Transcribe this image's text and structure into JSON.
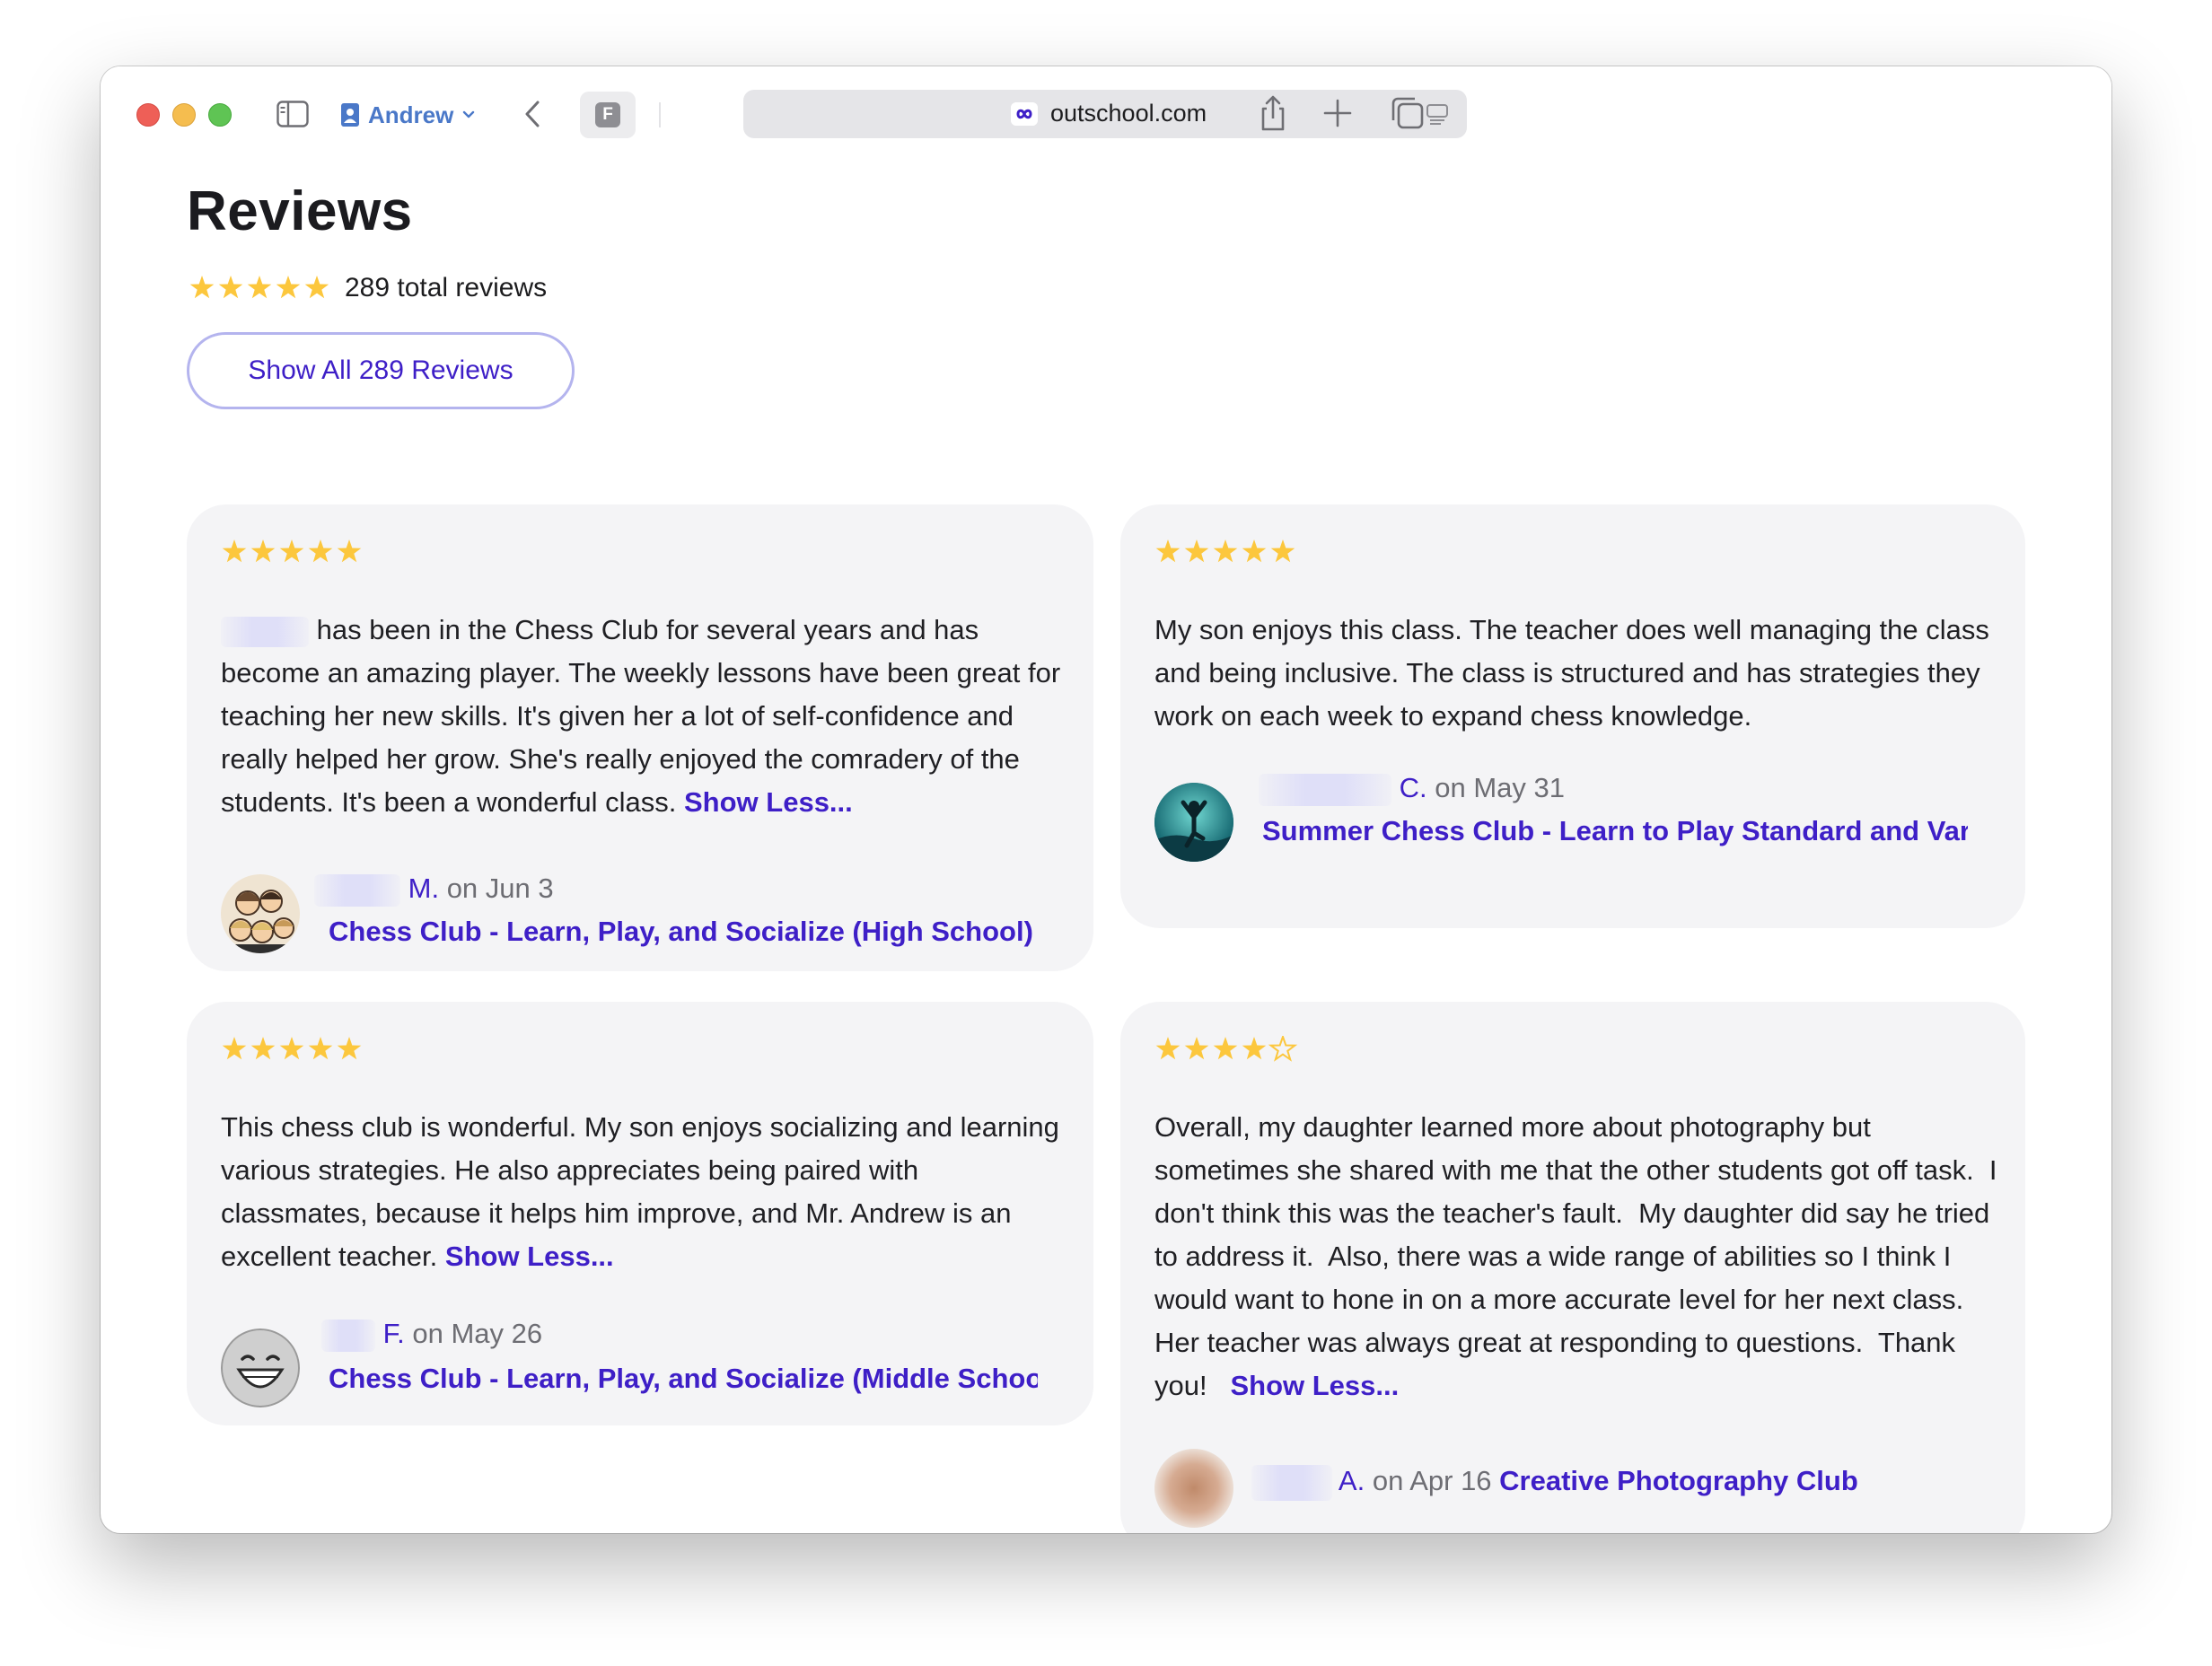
{
  "browser": {
    "profile_name": "Andrew",
    "favicon_letter": "F",
    "url": "outschool.com"
  },
  "page": {
    "title": "Reviews",
    "total_reviews": "289 total reviews",
    "show_all_label": "Show All 289 Reviews",
    "overall_rating": 5
  },
  "colors": {
    "accent": "#3e1fc7",
    "star": "#fcc73d",
    "card_bg": "#f4f4f6"
  },
  "reviews": [
    {
      "rating": 5,
      "text": "has been in the Chess Club for several years and has become an amazing player. The weekly lessons have been great for teaching her new skills. It's given her a lot of self-confidence and really helped her grow. She's really enjoyed the comradery of the students. It's been a wonderful class.",
      "show_less": "Show Less...",
      "initial": "M.",
      "date": "on Jun 3",
      "class_title": "Chess Club - Learn, Play, and Socialize (High School)",
      "avatar": "family-cartoon-avatar"
    },
    {
      "rating": 5,
      "text": "My son enjoys this class. The teacher does well managing the class and being inclusive. The class is structured and has strategies they work on each week to expand chess knowledge.",
      "show_less": "",
      "initial": "C.",
      "date": "on May 31",
      "class_title": "Summer Chess Club - Learn to Play Standard and Variant Chess",
      "avatar": "yoga-silhouette-avatar"
    },
    {
      "rating": 5,
      "text": "This chess club is wonderful. My son enjoys socializing and learning various strategies. He also appreciates being paired with classmates, because it helps him improve, and Mr. Andrew is an excellent teacher.",
      "show_less": "Show Less...",
      "initial": "F.",
      "date": "on May 26",
      "class_title": "Chess Club - Learn, Play, and Socialize (Middle School)",
      "avatar": "grinning-face-avatar"
    },
    {
      "rating": 4,
      "text": "Overall, my daughter learned more about photography but sometimes she shared with me that the other students got off task.  I don't think this was the teacher's fault.  My daughter did say he tried to address it.  Also, there was a wide range of abilities so I think I would want to hone in on a more accurate level for her next class.  Her teacher was always great at responding to questions.  Thank you!",
      "show_less": "Show Less...",
      "initial": "A.",
      "date": "on Apr 16",
      "class_title": "Creative Photography Club",
      "avatar": "blurred-photo-avatar"
    }
  ]
}
